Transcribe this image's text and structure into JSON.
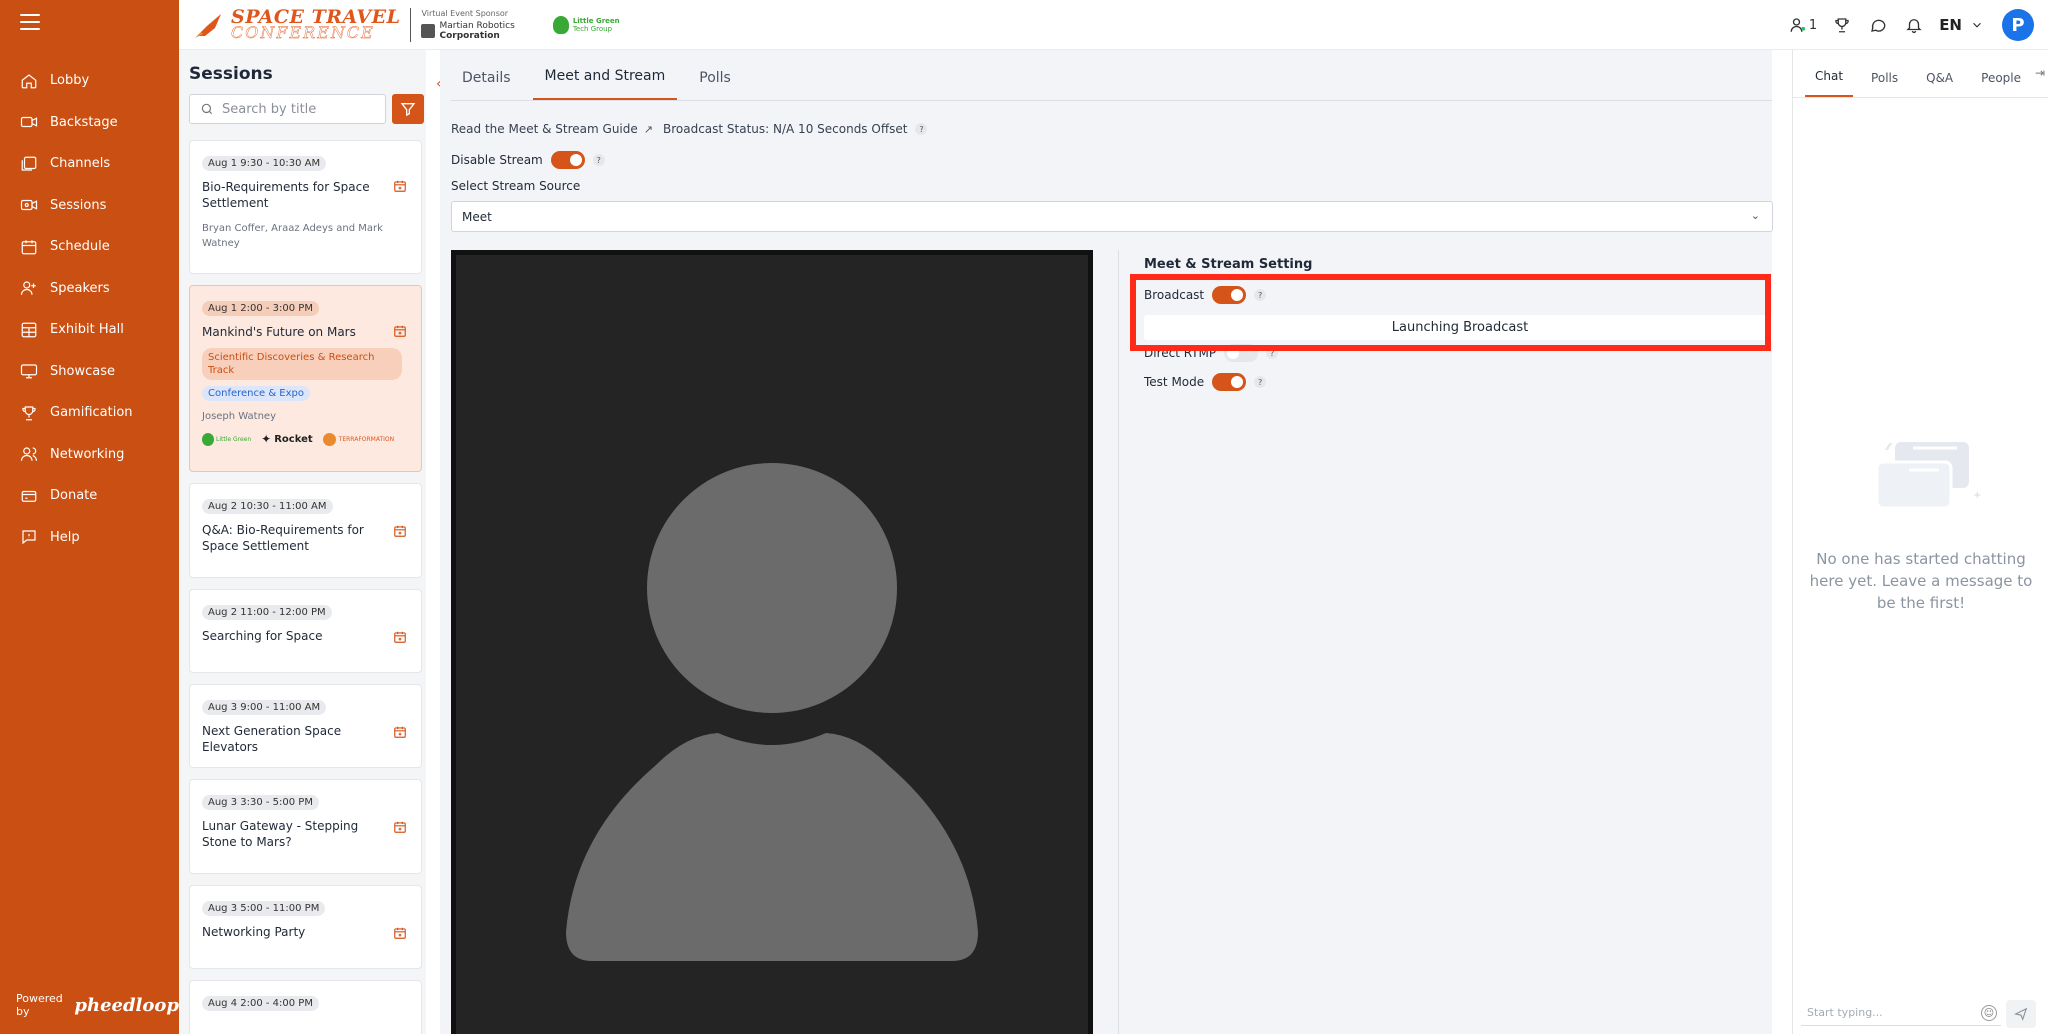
{
  "header": {
    "logo_line1": "SPACE TRAVEL",
    "logo_line2": "CONFERENCE",
    "sponsor_caption": "Virtual Event Sponsor",
    "sponsor_name_1": "Martian Robotics",
    "sponsor_name_2": "Corporation",
    "sponsor2_line1": "Little Green",
    "sponsor2_line2": "Tech Group",
    "people_count": "1",
    "language": "EN",
    "avatar_letter": "P"
  },
  "nav": {
    "items": [
      {
        "label": "Lobby",
        "icon": "home-icon"
      },
      {
        "label": "Backstage",
        "icon": "video-camera-icon"
      },
      {
        "label": "Channels",
        "icon": "channels-icon"
      },
      {
        "label": "Sessions",
        "icon": "sessions-icon"
      },
      {
        "label": "Schedule",
        "icon": "calendar-icon"
      },
      {
        "label": "Speakers",
        "icon": "speakers-icon"
      },
      {
        "label": "Exhibit Hall",
        "icon": "exhibit-icon"
      },
      {
        "label": "Showcase",
        "icon": "monitor-icon"
      },
      {
        "label": "Gamification",
        "icon": "trophy-icon"
      },
      {
        "label": "Networking",
        "icon": "networking-icon"
      },
      {
        "label": "Donate",
        "icon": "donate-icon"
      },
      {
        "label": "Help",
        "icon": "help-icon"
      }
    ],
    "powered_by": "Powered by",
    "brand": "pheedloop"
  },
  "sessions": {
    "title": "Sessions",
    "search_placeholder": "Search by title",
    "cards": [
      {
        "date": "Aug 1 9:30 - 10:30 AM",
        "title": "Bio-Requirements for Space Settlement",
        "speakers": "Bryan Coffer, Araaz Adeys and Mark Watney"
      },
      {
        "date": "Aug 1 2:00 - 3:00 PM",
        "title": "Mankind's Future on Mars",
        "track": "Scientific Discoveries & Research Track",
        "tag": "Conference & Expo",
        "speakers": "Joseph Watney",
        "sponsor_a": "Little Green",
        "sponsor_b": "Rocket",
        "sponsor_c": "TERRAFORMATION"
      },
      {
        "date": "Aug 2 10:30 - 11:00 AM",
        "title": "Q&A: Bio-Requirements for Space Settlement"
      },
      {
        "date": "Aug 2 11:00 - 12:00 PM",
        "title": "Searching for Space"
      },
      {
        "date": "Aug 3 9:00 - 11:00 AM",
        "title": "Next Generation Space Elevators"
      },
      {
        "date": "Aug 3 3:30 - 5:00 PM",
        "title": "Lunar Gateway - Stepping Stone to Mars?"
      },
      {
        "date": "Aug 3 5:00 - 11:00 PM",
        "title": "Networking Party"
      },
      {
        "date": "Aug 4 2:00 - 4:00 PM",
        "title": ""
      }
    ]
  },
  "main": {
    "tabs": [
      "Details",
      "Meet and Stream",
      "Polls"
    ],
    "guide_link": "Read the Meet & Stream Guide",
    "broadcast_status": "Broadcast Status: N/A 10 Seconds Offset",
    "disable_stream_label": "Disable Stream",
    "select_source_label": "Select Stream Source",
    "stream_source_value": "Meet",
    "settings_title": "Meet & Stream Setting",
    "broadcast_label": "Broadcast",
    "launch_label": "Launching Broadcast",
    "rtmp_label": "Direct RTMP",
    "test_mode_label": "Test Mode",
    "help_char": "?"
  },
  "right_panel": {
    "tabs": [
      "Chat",
      "Polls",
      "Q&A",
      "People"
    ],
    "empty_text": "No one has started chatting here yet. Leave a message to be the first!",
    "chat_placeholder": "Start typing..."
  },
  "colors": {
    "brand_orange": "#c94f12",
    "accent": "#d4541a",
    "highlight_red": "#ff2a17"
  }
}
